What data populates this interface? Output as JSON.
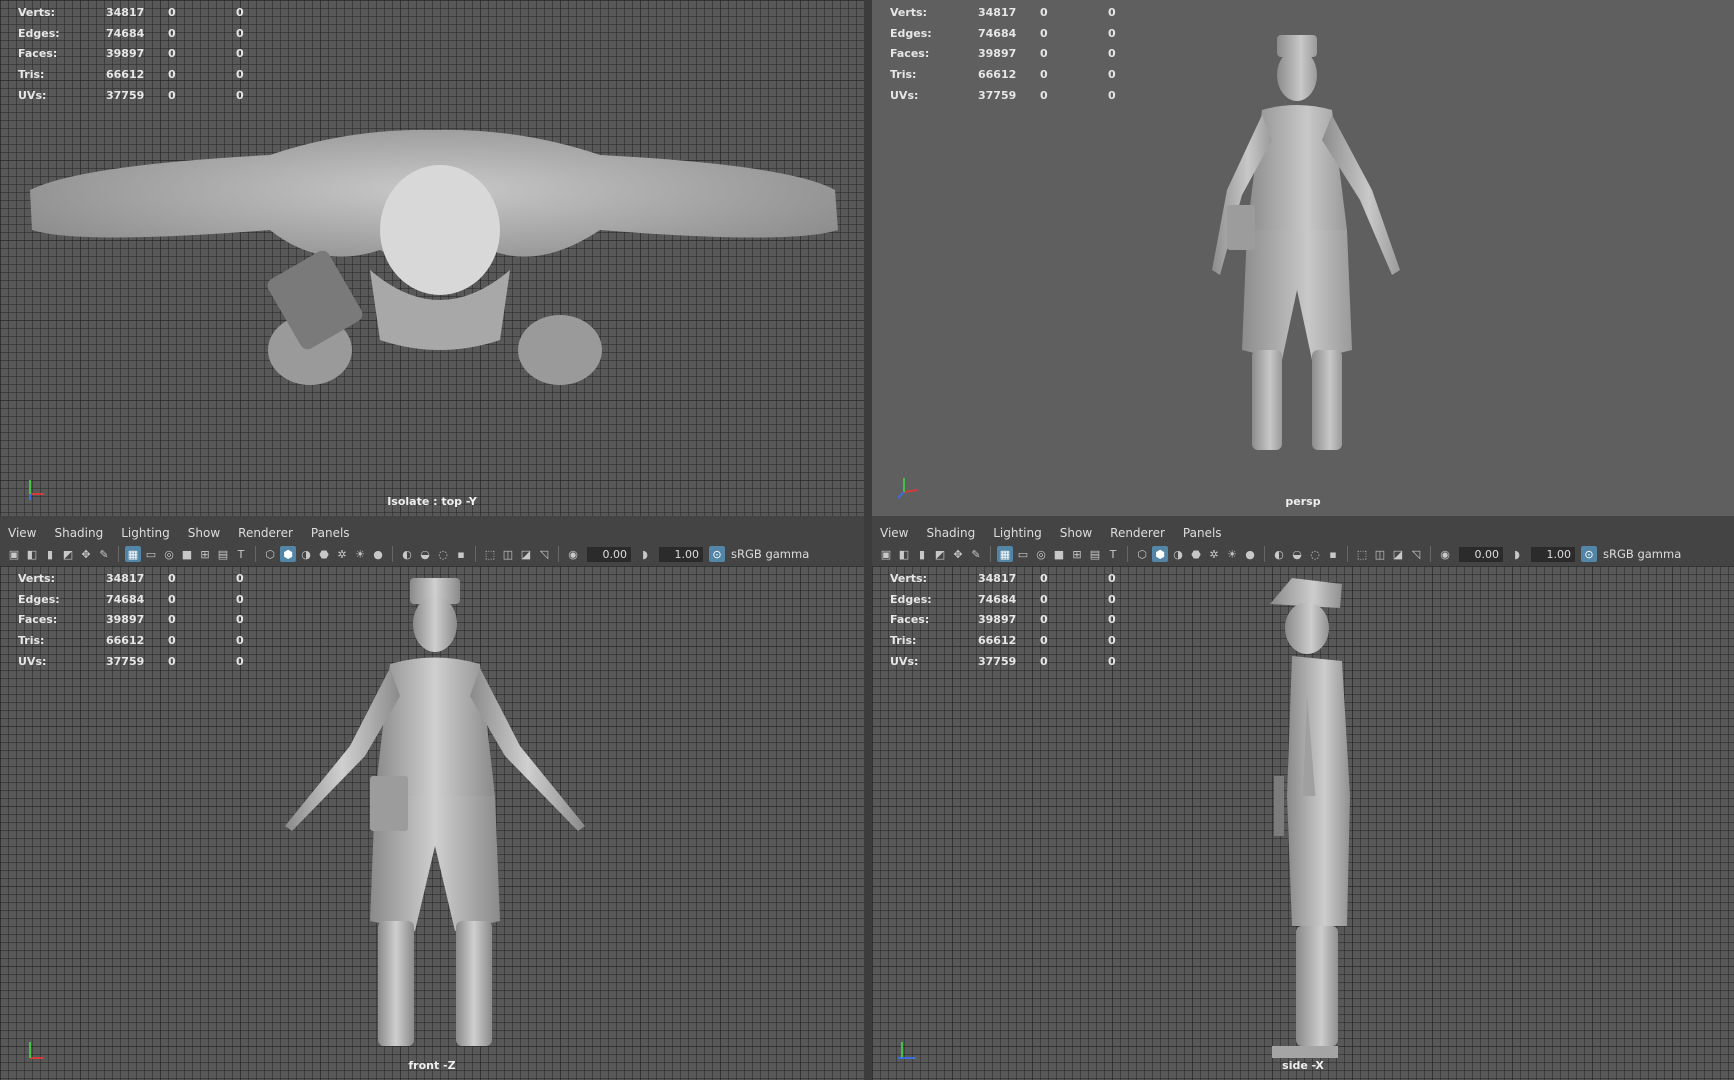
{
  "hud": {
    "rows": [
      {
        "label": "Verts:",
        "v1": "34817",
        "v2": "0",
        "v3": "0"
      },
      {
        "label": "Edges:",
        "v1": "74684",
        "v2": "0",
        "v3": "0"
      },
      {
        "label": "Faces:",
        "v1": "39897",
        "v2": "0",
        "v3": "0"
      },
      {
        "label": "Tris:",
        "v1": "66612",
        "v2": "0",
        "v3": "0"
      },
      {
        "label": "UVs:",
        "v1": "37759",
        "v2": "0",
        "v3": "0"
      }
    ]
  },
  "viewports": {
    "top": {
      "label": "Isolate : top -Y"
    },
    "persp": {
      "label": "persp"
    },
    "front": {
      "label": "front -Z"
    },
    "side": {
      "label": "side -X"
    }
  },
  "panel_menu": {
    "items": [
      "View",
      "Shading",
      "Lighting",
      "Show",
      "Renderer",
      "Panels"
    ]
  },
  "panel_toolbar": {
    "exposure_value": "0.00",
    "gamma_value": "1.00",
    "color_space": "sRGB gamma"
  },
  "axis": {
    "x_color": "#d33a3a",
    "y_color": "#45c14a",
    "z_color": "#3c6fd6"
  },
  "icons": [
    "camera-icon",
    "grid-icon",
    "wireframe-icon",
    "shaded-icon",
    "light-icon",
    "isolate-icon"
  ]
}
